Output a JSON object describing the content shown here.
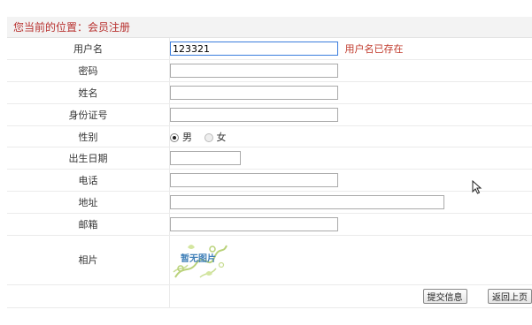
{
  "breadcrumb": "您当前的位置：会员注册",
  "fields": {
    "username": {
      "label": "用户名",
      "value": "123321",
      "error": "用户名已存在"
    },
    "password": {
      "label": "密码",
      "value": ""
    },
    "name": {
      "label": "姓名",
      "value": ""
    },
    "id_number": {
      "label": "身份证号",
      "value": ""
    },
    "gender": {
      "label": "性别",
      "options": [
        "男",
        "女"
      ],
      "selected": "男"
    },
    "birthdate": {
      "label": "出生日期",
      "value": ""
    },
    "phone": {
      "label": "电话",
      "value": ""
    },
    "address": {
      "label": "地址",
      "value": ""
    },
    "email": {
      "label": "邮箱",
      "value": ""
    },
    "photo": {
      "label": "相片",
      "placeholder_text": "暂无图片"
    }
  },
  "buttons": {
    "submit": "提交信息",
    "back": "返回上页"
  },
  "colors": {
    "accent": "#b8312f",
    "error": "#c0392b"
  }
}
